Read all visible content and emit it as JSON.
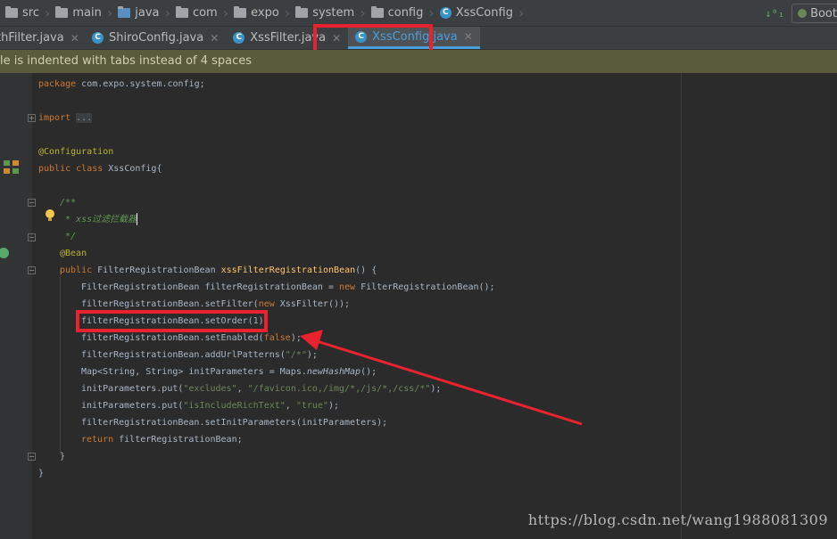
{
  "breadcrumb": {
    "items": [
      "src",
      "main",
      "java",
      "com",
      "expo",
      "system",
      "config"
    ],
    "current_class": "XssConfig"
  },
  "toolbar": {
    "run_config": "Boot",
    "sort_icon": "sort-icon"
  },
  "tabs": [
    {
      "label": "thFilter.java",
      "active": false
    },
    {
      "label": "ShiroConfig.java",
      "active": false
    },
    {
      "label": "XssFilter.java",
      "active": false
    },
    {
      "label": "XssConfig.java",
      "active": true
    }
  ],
  "banner": {
    "text": "le is indented with tabs instead of 4 spaces"
  },
  "code": {
    "l_package_kw": "package",
    "l_package_name": " com.expo.system.config;",
    "l_import_kw": "import",
    "l_import_fold": "...",
    "l_config_ann": "@Configuration",
    "l_class_kw": "public class",
    "l_class_name": " XssConfig{",
    "l_javadoc_open": "/**",
    "l_javadoc_text": " * xss过滤拦截器",
    "l_javadoc_close": " */",
    "l_bean_ann": "@Bean",
    "l_method_kw": "public",
    "l_method_type": " FilterRegistrationBean ",
    "l_method_name": "xssFilterRegistrationBean",
    "l_method_sig": "() {",
    "l1_a": "FilterRegistrationBean filterRegistrationBean = ",
    "l1_new": "new",
    "l1_b": " FilterRegistrationBean();",
    "l2_a": "filterRegistrationBean.setFilter(",
    "l2_new": "new",
    "l2_b": " XssFilter());",
    "l3": "filterRegistrationBean.setOrder(1);",
    "l4_a": "filterRegistrationBean.setEnabled(",
    "l4_false": "false",
    "l4_b": ");",
    "l5_a": "filterRegistrationBean.addUrlPatterns(",
    "l5_str": "\"/*\"",
    "l5_b": ");",
    "l6_a": "Map<String, String> initParameters = Maps.",
    "l6_method": "newHashMap",
    "l6_b": "();",
    "l7_a": "initParameters.put(",
    "l7_s1": "\"excludes\"",
    "l7_mid": ", ",
    "l7_s2": "\"/favicon.ico,/img/*,/js/*,/css/*\"",
    "l7_b": ");",
    "l8_a": "initParameters.put(",
    "l8_s1": "\"isIncludeRichText\"",
    "l8_mid": ", ",
    "l8_s2": "\"true\"",
    "l8_b": ");",
    "l9": "filterRegistrationBean.setInitParameters(initParameters);",
    "l10_kw": "return",
    "l10_b": " filterRegistrationBean;",
    "l_close_method": "}",
    "l_close_class": "}"
  },
  "watermark": "https://blog.csdn.net/wang1988081309",
  "colors": {
    "keyword": "#cc7832",
    "annotation": "#bbb529",
    "comment": "#629755",
    "string": "#6a8759",
    "method_decl": "#ffc66d",
    "highlight_box": "#e8232f",
    "active_tab": "#4a9fdb"
  }
}
